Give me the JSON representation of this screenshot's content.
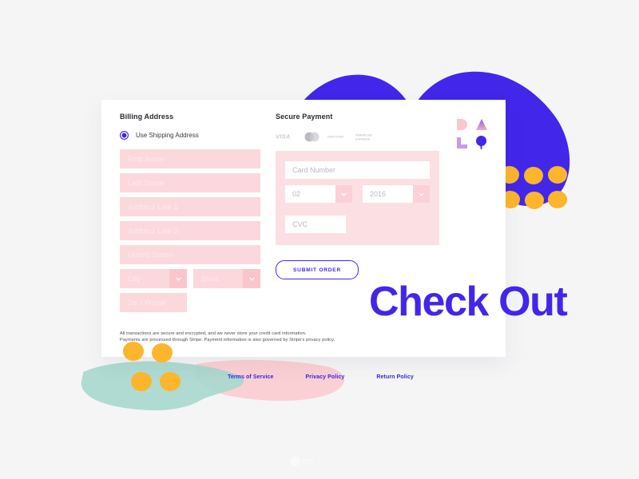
{
  "page": {
    "headline": "Check Out",
    "watermark": "cn"
  },
  "colors": {
    "accent_blue": "#4226ea",
    "panel_pink": "#fcdfe2",
    "input_pink": "#fbd8dc",
    "chevron_pink": "#f9c6cc",
    "dot_orange": "#fdb52b",
    "teal": "#a8d8ce",
    "blob_pink": "#fbd0d4",
    "page_bg": "#f5f5f6"
  },
  "billing": {
    "title": "Billing Address",
    "shipping_option": {
      "label": "Use Shipping Address",
      "selected": true
    },
    "fields": [
      {
        "name": "first-name",
        "placeholder": "First Name",
        "value": "",
        "type": "text"
      },
      {
        "name": "last-name",
        "placeholder": "Last Name",
        "value": "",
        "type": "text"
      },
      {
        "name": "address-line-1",
        "placeholder": "Address Line 1",
        "value": "",
        "type": "text"
      },
      {
        "name": "address-line-2",
        "placeholder": "Address Line 2",
        "value": "",
        "type": "text"
      },
      {
        "name": "country",
        "placeholder": "United States",
        "value": "United States",
        "type": "text"
      }
    ],
    "city": {
      "placeholder": "City",
      "value": "",
      "type": "select"
    },
    "state": {
      "placeholder": "State",
      "value": "",
      "type": "select"
    },
    "zip": {
      "placeholder": "Zip / Postal",
      "value": "",
      "type": "text"
    }
  },
  "payment": {
    "title": "Secure Payment",
    "accepted_cards": [
      {
        "name": "visa",
        "label": "VISA"
      },
      {
        "name": "mastercard",
        "label": "Mastercard"
      },
      {
        "name": "discover",
        "label": "DISCOVER"
      },
      {
        "name": "amex",
        "label": "AMERICAN EXPRESS"
      }
    ],
    "card_number": {
      "placeholder": "Card Number",
      "value": ""
    },
    "exp_month": {
      "value": "02",
      "placeholder": "02"
    },
    "exp_year": {
      "value": "2016",
      "placeholder": "2016"
    },
    "cvc": {
      "placeholder": "CVC",
      "value": ""
    },
    "submit_label": "SUBMIT ORDER"
  },
  "disclaimer": {
    "line1": "All transactions are secure and encrypted, and we never store your credit card information.",
    "line2": "Payments are processed through Stripe. Payment information is also governed by Stripe's privacy policy."
  },
  "footer": {
    "links": [
      {
        "name": "terms-of-service",
        "label": "Terms of Service"
      },
      {
        "name": "privacy-policy",
        "label": "Privacy Policy"
      },
      {
        "name": "return-policy",
        "label": "Return Policy"
      }
    ]
  },
  "decorations": {
    "glyphs": [
      {
        "name": "d-shape",
        "color": "#fbc6cf"
      },
      {
        "name": "triangle",
        "color": "#b07ae8"
      },
      {
        "name": "l-shape",
        "color": "#c79ae8"
      },
      {
        "name": "balloon-pin",
        "color": "#4226ea"
      }
    ],
    "dot_grid_count": 8,
    "bottom_dot_count": 4
  }
}
